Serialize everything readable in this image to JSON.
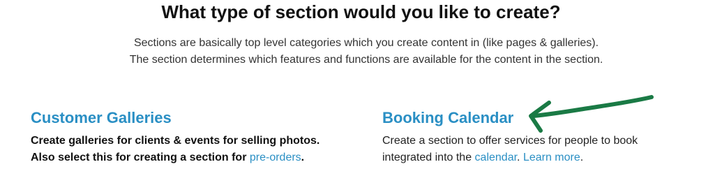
{
  "heading": "What type of section would you like to create?",
  "intro": {
    "line1": "Sections are basically top level categories which you create content in (like pages & galleries).",
    "line2": "The section determines which features and functions are available for the content in the section."
  },
  "options": {
    "customer_galleries": {
      "title": "Customer Galleries",
      "line1": "Create galleries for clients & events for selling photos.",
      "line2_prefix": "Also select this for creating a section for ",
      "line2_link": "pre-orders",
      "line2_suffix": "."
    },
    "booking_calendar": {
      "title": "Booking Calendar",
      "line1": "Create a section to offer services for people to book",
      "line2_prefix": "integrated into the ",
      "line2_link": "calendar",
      "line2_mid": ". ",
      "line2_link2": "Learn more",
      "line2_suffix": "."
    }
  },
  "annotation": {
    "arrow_color": "#1a7a45",
    "icon": "hand-drawn-arrow-icon"
  },
  "colors": {
    "link": "#2a8fc4",
    "heading": "#111111",
    "text": "#222222"
  }
}
